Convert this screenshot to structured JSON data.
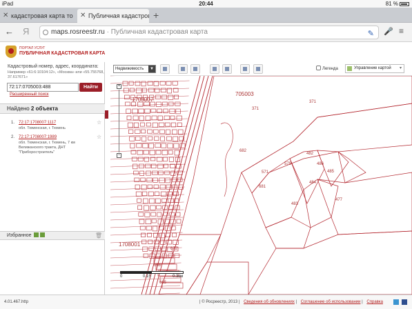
{
  "status": {
    "device": "iPad",
    "time": "20:44",
    "battery": "81 %"
  },
  "tabs": [
    {
      "label": "кадастровая карта то"
    },
    {
      "label": "Публичная кадастрова"
    }
  ],
  "address": {
    "domain": "maps.rosreestr.ru",
    "title": " · Публичная кадастровая карта"
  },
  "portal": {
    "subtitle": "ПОРТАЛ УСЛУГ",
    "title": "ПУБЛИЧНАЯ КАДАСТРОВАЯ КАРТА"
  },
  "search": {
    "hint": "Кадастровый номер, адрес, координата:",
    "example": "Например «61:6:10104:12», «Москва» или «55.755768, 37.617671»",
    "value": "72:17:0705003:488",
    "button": "Найти",
    "advanced": "Расширенный поиск"
  },
  "results": {
    "prefix": "Найдено",
    "count": "2 объекта",
    "items": [
      {
        "num": "1.",
        "id": "72:17:1708007:1117",
        "address": "обл. Тюменская, г. Тюмень"
      },
      {
        "num": "2.",
        "id": "72:17:1708007:1989",
        "address": "обл. Тюменская, г. Тюмень, 7 км Велижанского тракта, ДНТ \"Приборостроитель\""
      }
    ]
  },
  "favorites": {
    "label": "Избранное"
  },
  "toolbar": {
    "layer": "Недвижимость",
    "legend": "Легенда",
    "map_control": "Управление картой"
  },
  "map": {
    "labels": [
      "705003",
      "371",
      "371",
      "1708007",
      "482",
      "486",
      "485",
      "579",
      "484",
      "681",
      "483",
      "477",
      "682",
      "672",
      "666",
      "665",
      "1708001",
      "571"
    ],
    "scale": [
      "0",
      "0.15",
      "0.3км"
    ]
  },
  "footer": {
    "url": "4.01.467.http",
    "copy": "| © Росреестр, 2013 |",
    "links": [
      "Сведения об обновлениях",
      "Соглашение об использовании",
      "Справка"
    ]
  }
}
